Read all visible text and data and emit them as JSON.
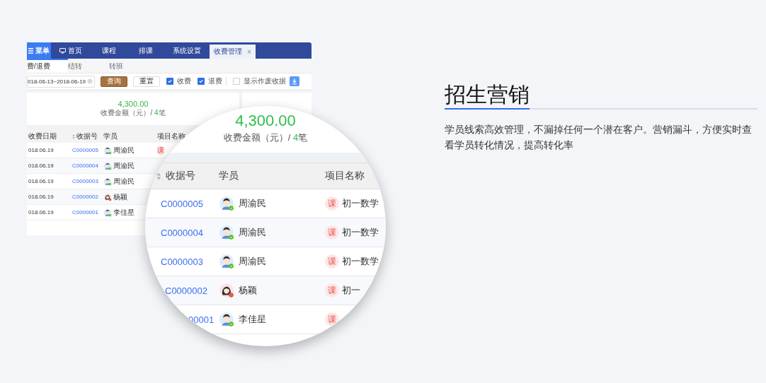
{
  "app": {
    "menu": {
      "label": "菜单"
    },
    "nav": [
      {
        "label": "首页",
        "kind": "icon",
        "selected": false
      },
      {
        "label": "课程",
        "kind": "plain",
        "selected": false
      },
      {
        "label": "排课",
        "kind": "plain",
        "selected": false
      },
      {
        "label": "系统设置",
        "kind": "plain",
        "selected": false
      },
      {
        "label": "收费管理",
        "kind": "closable",
        "selected": true,
        "close": "×"
      }
    ],
    "subtabs": [
      {
        "label": "费/退费",
        "selected": true
      },
      {
        "label": "结转",
        "selected": false
      },
      {
        "label": "转班",
        "selected": false
      }
    ],
    "filters": {
      "date_range": "018-06-13~2018-06-19",
      "query_button": "查询",
      "reset_button": "重置",
      "checks": [
        {
          "label": "收费",
          "checked": true
        },
        {
          "label": "退费",
          "checked": true
        },
        {
          "label": "显示作废收据",
          "checked": false
        }
      ]
    },
    "summary": {
      "amount": "4,300.00",
      "label": "收费金额（元）/",
      "count": "4",
      "unit": "笔"
    },
    "table": {
      "columns": [
        {
          "label": "收费日期",
          "sortable": false
        },
        {
          "label": "收据号",
          "sortable": true
        },
        {
          "label": "学员",
          "sortable": false
        },
        {
          "label": "项目名称",
          "sortable": false
        }
      ],
      "rows": [
        {
          "date": "018.06.19",
          "receipt": "C0000005",
          "student": "周渝民",
          "kind": "boy",
          "tag": "课"
        },
        {
          "date": "018.06.19",
          "receipt": "C0000004",
          "student": "周渝民",
          "kind": "boy"
        },
        {
          "date": "018.06.19",
          "receipt": "C0000003",
          "student": "周渝民",
          "kind": "boy"
        },
        {
          "date": "018.06.19",
          "receipt": "C0000002",
          "student": "杨颖",
          "kind": "girl"
        },
        {
          "date": "018.06.19",
          "receipt": "C0000001",
          "student": "李佳星",
          "kind": "boy"
        }
      ]
    }
  },
  "magnifier": {
    "amount": "4,300.00",
    "label": "收费金额（元）/",
    "count": "4",
    "unit": "笔",
    "columns": [
      {
        "label": "收据号",
        "sortable": true
      },
      {
        "label": "学员",
        "sortable": false
      },
      {
        "label": "项目名称",
        "sortable": false
      }
    ],
    "rows": [
      {
        "receipt": "C0000005",
        "student": "周渝民",
        "kind": "boy",
        "tag": "课",
        "project": "初一数学"
      },
      {
        "receipt": "C0000004",
        "student": "周渝民",
        "kind": "boy",
        "tag": "课",
        "project": "初一数学"
      },
      {
        "receipt": "C0000003",
        "student": "周渝民",
        "kind": "boy",
        "tag": "课",
        "project": "初一数学"
      },
      {
        "receipt": "C0000002",
        "student": "杨颖",
        "kind": "girl",
        "tag": "课",
        "project": "初一"
      },
      {
        "receipt": "00001",
        "student": "李佳星",
        "kind": "boy",
        "tag": "课"
      }
    ]
  },
  "feature": {
    "title": "招生营销",
    "description": "学员线索高效管理，不漏掉任何一个潜在客户。营销漏斗，方便实时查看学员转化情况，提高转化率"
  }
}
